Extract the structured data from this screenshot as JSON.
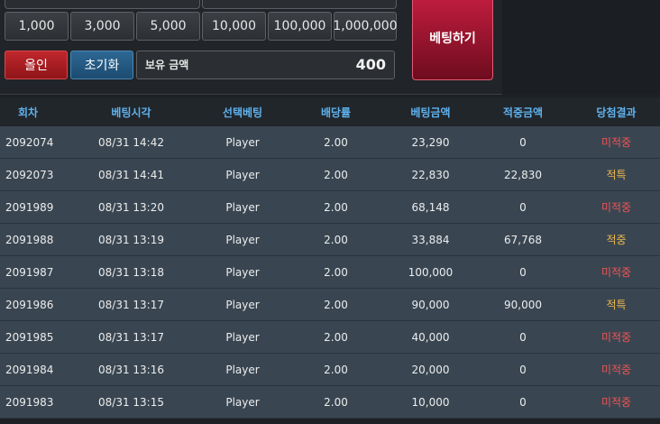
{
  "chips": [
    "1,000",
    "3,000",
    "5,000",
    "10,000",
    "100,000",
    "1,000,000"
  ],
  "buttons": {
    "all_in": "올인",
    "reset": "초기화",
    "bet": "베팅하기"
  },
  "balance": {
    "label": "보유 금액",
    "value": "400"
  },
  "table": {
    "headers": [
      "회차",
      "베팅시각",
      "선택베팅",
      "배당률",
      "베팅금액",
      "적중금액",
      "당첨결과"
    ],
    "rows": [
      {
        "round": "2092074",
        "time": "08/31 14:42",
        "choice": "Player",
        "odds": "2.00",
        "bet": "23,290",
        "win": "0",
        "result": "미적중",
        "status": "miss"
      },
      {
        "round": "2092073",
        "time": "08/31 14:41",
        "choice": "Player",
        "odds": "2.00",
        "bet": "22,830",
        "win": "22,830",
        "result": "적특",
        "status": "hit"
      },
      {
        "round": "2091989",
        "time": "08/31 13:20",
        "choice": "Player",
        "odds": "2.00",
        "bet": "68,148",
        "win": "0",
        "result": "미적중",
        "status": "miss"
      },
      {
        "round": "2091988",
        "time": "08/31 13:19",
        "choice": "Player",
        "odds": "2.00",
        "bet": "33,884",
        "win": "67,768",
        "result": "적중",
        "status": "hit"
      },
      {
        "round": "2091987",
        "time": "08/31 13:18",
        "choice": "Player",
        "odds": "2.00",
        "bet": "100,000",
        "win": "0",
        "result": "미적중",
        "status": "miss"
      },
      {
        "round": "2091986",
        "time": "08/31 13:17",
        "choice": "Player",
        "odds": "2.00",
        "bet": "90,000",
        "win": "90,000",
        "result": "적특",
        "status": "hit"
      },
      {
        "round": "2091985",
        "time": "08/31 13:17",
        "choice": "Player",
        "odds": "2.00",
        "bet": "40,000",
        "win": "0",
        "result": "미적중",
        "status": "miss"
      },
      {
        "round": "2091984",
        "time": "08/31 13:16",
        "choice": "Player",
        "odds": "2.00",
        "bet": "20,000",
        "win": "0",
        "result": "미적중",
        "status": "miss"
      },
      {
        "round": "2091983",
        "time": "08/31 13:15",
        "choice": "Player",
        "odds": "2.00",
        "bet": "10,000",
        "win": "0",
        "result": "미적중",
        "status": "miss"
      }
    ]
  },
  "colors": {
    "header_text": "#5fb2ee",
    "miss": "#f05454",
    "hit": "#f0b84c",
    "allin": "#b0212a",
    "reset": "#255b84",
    "bet": "#a0162f"
  }
}
